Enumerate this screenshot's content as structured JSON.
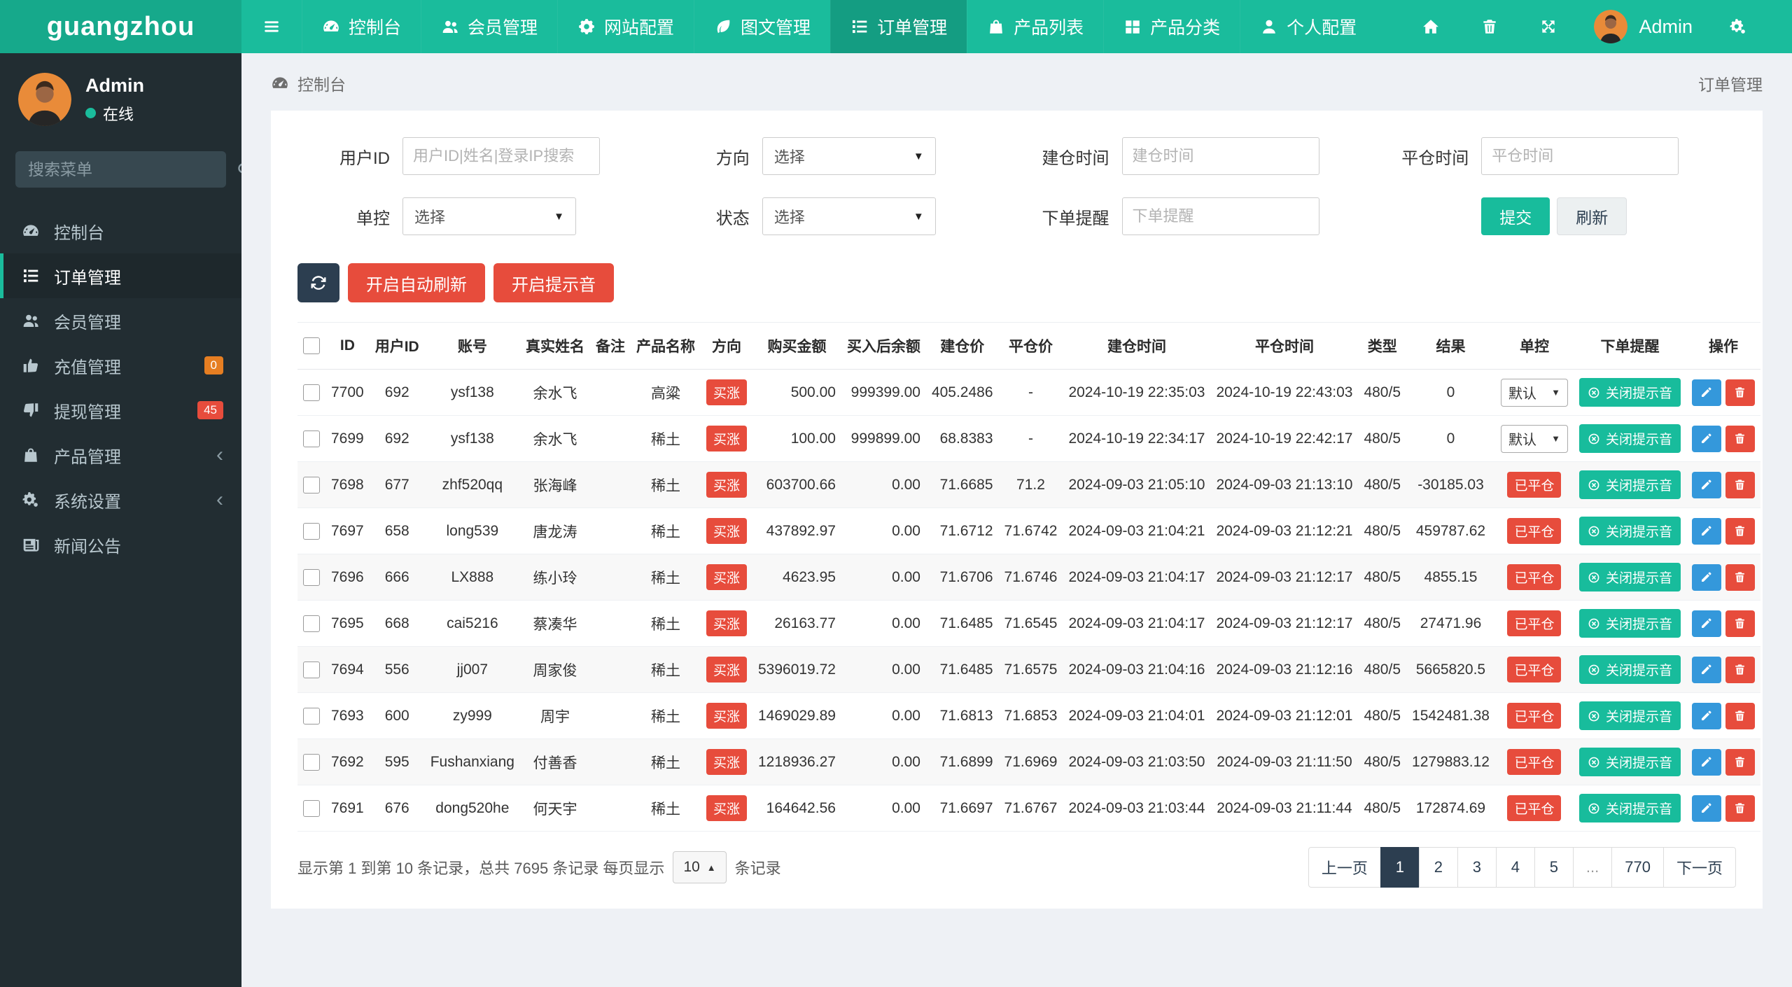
{
  "theme": {
    "navbar": "#1abc9c",
    "navbar_brand": "#16a98b",
    "navbar_active": "#149d82",
    "sidebar": "#222d32",
    "sidebar_active": "#1e282c",
    "accent": "#1abc9c",
    "danger": "#e74c3c",
    "dark": "#2c3e50",
    "green_btn": "#18bc9c",
    "edit_blue": "#3498db"
  },
  "navbar": {
    "brand": "guangzhou",
    "items": [
      {
        "label": "控制台",
        "icon": "dashboard",
        "active": false
      },
      {
        "label": "会员管理",
        "icon": "users",
        "active": false
      },
      {
        "label": "网站配置",
        "icon": "gear",
        "active": false
      },
      {
        "label": "图文管理",
        "icon": "leaf",
        "active": false
      },
      {
        "label": "订单管理",
        "icon": "list",
        "active": true
      },
      {
        "label": "产品列表",
        "icon": "bag",
        "active": false
      },
      {
        "label": "产品分类",
        "icon": "grid",
        "active": false
      },
      {
        "label": "个人配置",
        "icon": "user",
        "active": false
      }
    ],
    "right_icons": [
      "home",
      "trash",
      "expand"
    ],
    "user_name": "Admin"
  },
  "sidebar": {
    "user": {
      "name": "Admin",
      "status": "在线"
    },
    "search_placeholder": "搜索菜单",
    "items": [
      {
        "label": "控制台",
        "icon": "dashboard"
      },
      {
        "label": "订单管理",
        "icon": "list",
        "active": true
      },
      {
        "label": "会员管理",
        "icon": "users"
      },
      {
        "label": "充值管理",
        "icon": "thumbs-up",
        "badge": "0",
        "badge_color": "#e67e22"
      },
      {
        "label": "提现管理",
        "icon": "thumbs-down",
        "badge": "45",
        "badge_color": "#e74c3c"
      },
      {
        "label": "产品管理",
        "icon": "bag",
        "chevron": true
      },
      {
        "label": "系统设置",
        "icon": "gears",
        "chevron": true
      },
      {
        "label": "新闻公告",
        "icon": "news"
      }
    ]
  },
  "breadcrumb": {
    "left": "控制台",
    "right": "订单管理"
  },
  "filters": {
    "fields": [
      {
        "key": "user-id",
        "label": "用户ID",
        "type": "input",
        "placeholder": "用户ID|姓名|登录IP搜索"
      },
      {
        "key": "direction",
        "label": "方向",
        "type": "select",
        "value": "选择"
      },
      {
        "key": "open-time",
        "label": "建仓时间",
        "type": "input",
        "placeholder": "建仓时间"
      },
      {
        "key": "close-time",
        "label": "平仓时间",
        "type": "input",
        "placeholder": "平仓时间"
      },
      {
        "key": "control",
        "label": "单控",
        "type": "select",
        "value": "选择"
      },
      {
        "key": "status",
        "label": "状态",
        "type": "select",
        "value": "选择"
      },
      {
        "key": "order-alert",
        "label": "下单提醒",
        "type": "input",
        "placeholder": "下单提醒"
      },
      {
        "key": "actions",
        "type": "buttons"
      }
    ],
    "submit": "提交",
    "refresh": "刷新"
  },
  "toolbar": {
    "auto_refresh": "开启自动刷新",
    "sound": "开启提示音"
  },
  "table": {
    "columns": [
      "",
      "ID",
      "用户ID",
      "账号",
      "真实姓名",
      "备注",
      "产品名称",
      "方向",
      "购买金额",
      "买入后余额",
      "建仓价",
      "平仓价",
      "建仓时间",
      "平仓时间",
      "类型",
      "结果",
      "单控",
      "下单提醒",
      "操作"
    ],
    "rows": [
      {
        "id": "7700",
        "uid": "692",
        "account": "ysf138",
        "name": "余水飞",
        "note": "",
        "product": "高粱",
        "direction": "买涨",
        "amount": "500.00",
        "balance": "999399.00",
        "open_price": "405.2486",
        "close_price": "-",
        "open_time": "2024-10-19 22:35:03",
        "close_time": "2024-10-19 22:43:03",
        "type": "480/5",
        "result": "0",
        "control": "默认",
        "control_type": "select",
        "alert": "关闭提示音"
      },
      {
        "id": "7699",
        "uid": "692",
        "account": "ysf138",
        "name": "余水飞",
        "note": "",
        "product": "稀土",
        "direction": "买涨",
        "amount": "100.00",
        "balance": "999899.00",
        "open_price": "68.8383",
        "close_price": "-",
        "open_time": "2024-10-19 22:34:17",
        "close_time": "2024-10-19 22:42:17",
        "type": "480/5",
        "result": "0",
        "control": "默认",
        "control_type": "select",
        "alert": "关闭提示音"
      },
      {
        "id": "7698",
        "uid": "677",
        "account": "zhf520qq",
        "name": "张海峰",
        "note": "",
        "product": "稀土",
        "direction": "买涨",
        "amount": "603700.66",
        "balance": "0.00",
        "open_price": "71.6685",
        "close_price": "71.2",
        "open_time": "2024-09-03 21:05:10",
        "close_time": "2024-09-03 21:13:10",
        "type": "480/5",
        "result": "-30185.03",
        "control": "已平仓",
        "control_type": "badge",
        "alert": "关闭提示音"
      },
      {
        "id": "7697",
        "uid": "658",
        "account": "long539",
        "name": "唐龙涛",
        "note": "",
        "product": "稀土",
        "direction": "买涨",
        "amount": "437892.97",
        "balance": "0.00",
        "open_price": "71.6712",
        "close_price": "71.6742",
        "open_time": "2024-09-03 21:04:21",
        "close_time": "2024-09-03 21:12:21",
        "type": "480/5",
        "result": "459787.62",
        "control": "已平仓",
        "control_type": "badge",
        "alert": "关闭提示音"
      },
      {
        "id": "7696",
        "uid": "666",
        "account": "LX888",
        "name": "练小玲",
        "note": "",
        "product": "稀土",
        "direction": "买涨",
        "amount": "4623.95",
        "balance": "0.00",
        "open_price": "71.6706",
        "close_price": "71.6746",
        "open_time": "2024-09-03 21:04:17",
        "close_time": "2024-09-03 21:12:17",
        "type": "480/5",
        "result": "4855.15",
        "control": "已平仓",
        "control_type": "badge",
        "alert": "关闭提示音"
      },
      {
        "id": "7695",
        "uid": "668",
        "account": "cai5216",
        "name": "蔡凑华",
        "note": "",
        "product": "稀土",
        "direction": "买涨",
        "amount": "26163.77",
        "balance": "0.00",
        "open_price": "71.6485",
        "close_price": "71.6545",
        "open_time": "2024-09-03 21:04:17",
        "close_time": "2024-09-03 21:12:17",
        "type": "480/5",
        "result": "27471.96",
        "control": "已平仓",
        "control_type": "badge",
        "alert": "关闭提示音"
      },
      {
        "id": "7694",
        "uid": "556",
        "account": "jj007",
        "name": "周家俊",
        "note": "",
        "product": "稀土",
        "direction": "买涨",
        "amount": "5396019.72",
        "balance": "0.00",
        "open_price": "71.6485",
        "close_price": "71.6575",
        "open_time": "2024-09-03 21:04:16",
        "close_time": "2024-09-03 21:12:16",
        "type": "480/5",
        "result": "5665820.5",
        "control": "已平仓",
        "control_type": "badge",
        "alert": "关闭提示音"
      },
      {
        "id": "7693",
        "uid": "600",
        "account": "zy999",
        "name": "周宇",
        "note": "",
        "product": "稀土",
        "direction": "买涨",
        "amount": "1469029.89",
        "balance": "0.00",
        "open_price": "71.6813",
        "close_price": "71.6853",
        "open_time": "2024-09-03 21:04:01",
        "close_time": "2024-09-03 21:12:01",
        "type": "480/5",
        "result": "1542481.38",
        "control": "已平仓",
        "control_type": "badge",
        "alert": "关闭提示音"
      },
      {
        "id": "7692",
        "uid": "595",
        "account": "Fushanxiang",
        "name": "付善香",
        "note": "",
        "product": "稀土",
        "direction": "买涨",
        "amount": "1218936.27",
        "balance": "0.00",
        "open_price": "71.6899",
        "close_price": "71.6969",
        "open_time": "2024-09-03 21:03:50",
        "close_time": "2024-09-03 21:11:50",
        "type": "480/5",
        "result": "1279883.12",
        "control": "已平仓",
        "control_type": "badge",
        "alert": "关闭提示音"
      },
      {
        "id": "7691",
        "uid": "676",
        "account": "dong520he",
        "name": "何天宇",
        "note": "",
        "product": "稀土",
        "direction": "买涨",
        "amount": "164642.56",
        "balance": "0.00",
        "open_price": "71.6697",
        "close_price": "71.6767",
        "open_time": "2024-09-03 21:03:44",
        "close_time": "2024-09-03 21:11:44",
        "type": "480/5",
        "result": "172874.69",
        "control": "已平仓",
        "control_type": "badge",
        "alert": "关闭提示音"
      }
    ]
  },
  "footer": {
    "summary_prefix": "显示第 1 到第 10 条记录，总共 7695 条记录 每页显示",
    "page_size": "10",
    "summary_suffix": "条记录",
    "pages": [
      "上一页",
      "1",
      "2",
      "3",
      "4",
      "5",
      "...",
      "770",
      "下一页"
    ],
    "active_page": "1"
  }
}
